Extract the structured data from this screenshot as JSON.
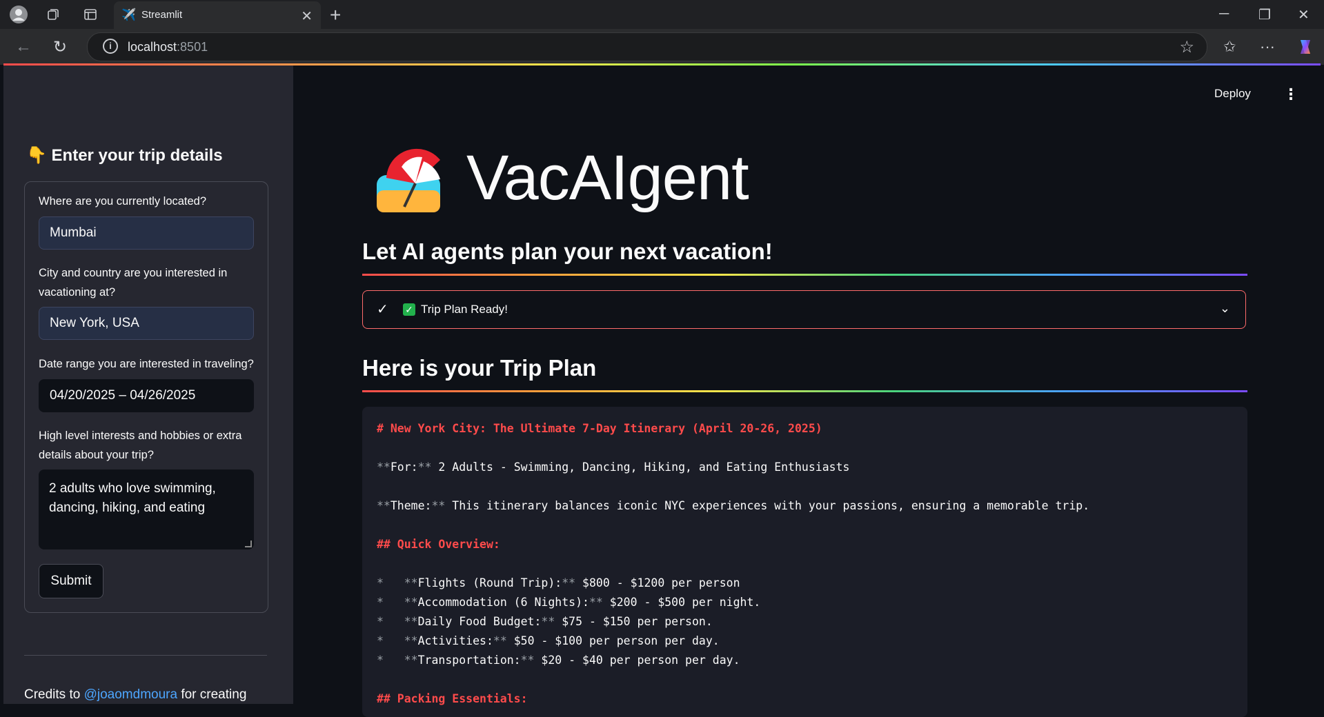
{
  "browser": {
    "tab_title": "Streamlit",
    "url_host": "localhost",
    "url_port": ":8501"
  },
  "sidebar": {
    "title": "👇 Enter your trip details",
    "fields": [
      {
        "label": "Where are you currently located?",
        "value": "Mumbai"
      },
      {
        "label": "City and country are you interested in vacationing at?",
        "value": "New York, USA"
      },
      {
        "label": "Date range you are interested in traveling?",
        "value": "04/20/2025 – 04/26/2025"
      },
      {
        "label": "High level interests and hobbies or extra details about your trip?",
        "value": "2 adults who love swimming, dancing, hiking, and eating"
      }
    ],
    "submit_label": "Submit",
    "credits_prefix": "Credits to ",
    "credits_link": "@joaomdmoura",
    "credits_suffix": " for creating"
  },
  "header": {
    "deploy_label": "Deploy"
  },
  "main": {
    "title": "VacAIgent",
    "subtitle": "Let AI agents plan your next vacation!",
    "status_label": "Trip Plan Ready!",
    "plan_heading": "Here is your Trip Plan",
    "plan_lines": [
      {
        "kind": "h1",
        "text": "# New York City: The Ultimate 7-Day Itinerary (April 20-26, 2025)"
      },
      {
        "kind": "blank",
        "text": ""
      },
      {
        "kind": "bold",
        "pre": "",
        "label": "For:",
        "text": " 2 Adults - Swimming, Dancing, Hiking, and Eating Enthusiasts"
      },
      {
        "kind": "blank",
        "text": ""
      },
      {
        "kind": "bold",
        "pre": "",
        "label": "Theme:",
        "text": " This itinerary balances iconic NYC experiences with your passions, ensuring a memorable trip."
      },
      {
        "kind": "blank",
        "text": ""
      },
      {
        "kind": "h1",
        "text": "## Quick Overview:"
      },
      {
        "kind": "blank",
        "text": ""
      },
      {
        "kind": "bold",
        "pre": "*   ",
        "label": "Flights (Round Trip):",
        "text": " $800 - $1200 per person"
      },
      {
        "kind": "bold",
        "pre": "*   ",
        "label": "Accommodation (6 Nights):",
        "text": " $200 - $500 per night."
      },
      {
        "kind": "bold",
        "pre": "*   ",
        "label": "Daily Food Budget:",
        "text": " $75 - $150 per person."
      },
      {
        "kind": "bold",
        "pre": "*   ",
        "label": "Activities:",
        "text": " $50 - $100 per person per day."
      },
      {
        "kind": "bold",
        "pre": "*   ",
        "label": "Transportation:",
        "text": " $20 - $40 per person per day."
      },
      {
        "kind": "blank",
        "text": ""
      },
      {
        "kind": "h1",
        "text": "## Packing Essentials:"
      }
    ]
  },
  "colors": {
    "accent": "#ff4b4b",
    "link": "#4da6ff",
    "sidebar_bg": "#262730",
    "main_bg": "#0e1117"
  }
}
